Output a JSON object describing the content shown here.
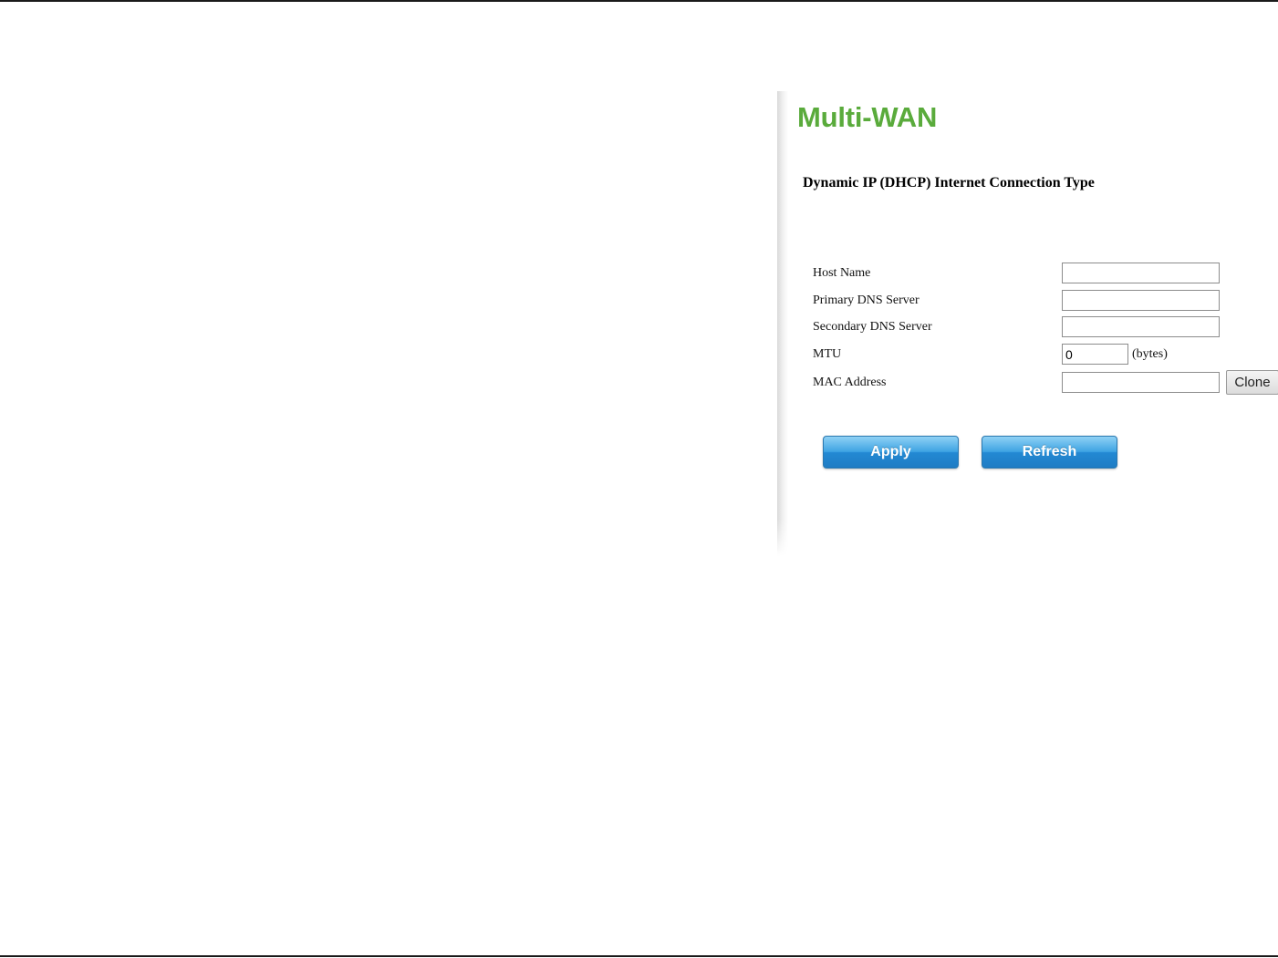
{
  "page": {
    "title": "Multi-WAN",
    "subtitle": "Dynamic IP (DHCP) Internet Connection Type"
  },
  "form": {
    "host_name": {
      "label": "Host Name",
      "value": ""
    },
    "primary_dns": {
      "label": "Primary DNS Server",
      "value": ""
    },
    "secondary_dns": {
      "label": "Secondary DNS Server",
      "value": ""
    },
    "mtu": {
      "label": "MTU",
      "value": "0",
      "unit": "(bytes)"
    },
    "mac_address": {
      "label": "MAC Address",
      "value": "",
      "clone_label": "Clone"
    }
  },
  "actions": {
    "apply_label": "Apply",
    "refresh_label": "Refresh"
  },
  "colors": {
    "title": "#5aab3c",
    "button_blue": "#2389d3",
    "rule": "#1a1a1a"
  }
}
